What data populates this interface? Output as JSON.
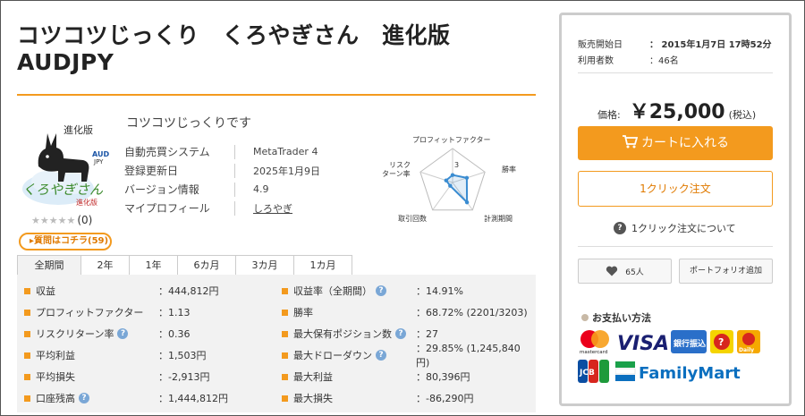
{
  "product": {
    "title": "コツコツじっくり　くろやぎさん　進化版 AUDJPY",
    "subtitle": "コツコツじっくりです",
    "review_count": "(0)",
    "qa_label": "▸質問はコチラ(59)",
    "logo": {
      "badge": "進化版",
      "pair_top": "AUD",
      "pair_bottom": "JPY",
      "script": "くろやぎさん",
      "script_sub": "進化版"
    },
    "info": [
      {
        "key": "自動売買システム",
        "value": "MetaTrader 4"
      },
      {
        "key": "登録更新日",
        "value": "2025年1月9日"
      },
      {
        "key": "バージョン情報",
        "value": "4.9"
      },
      {
        "key": "マイプロフィール",
        "value": "しろやぎ"
      }
    ]
  },
  "radar": {
    "labels": {
      "top": "プロフィットファクター",
      "right": "勝率",
      "bottom_right": "計測期間",
      "bottom_left": "取引回数",
      "left": "リスク\nターン率"
    },
    "center_value": "3",
    "values": [
      1.1,
      2.2,
      3.6,
      0.6,
      1.0
    ],
    "max": 5
  },
  "tabs": [
    "全期間",
    "2年",
    "1年",
    "6カ月",
    "3カ月",
    "1カ月"
  ],
  "stats_left": [
    {
      "label": "収益",
      "value": "：444,812円",
      "help": false
    },
    {
      "label": "プロフィットファクター",
      "value": "：1.13",
      "help": false
    },
    {
      "label": "リスクリターン率",
      "value": "：0.36",
      "help": true
    },
    {
      "label": "平均利益",
      "value": "：1,503円",
      "help": false
    },
    {
      "label": "平均損失",
      "value": "：-2,913円",
      "help": false
    },
    {
      "label": "口座残高",
      "value": "：1,444,812円",
      "help": true
    }
  ],
  "stats_right": [
    {
      "label": "収益率（全期間）",
      "value": "：14.91%",
      "help": true
    },
    {
      "label": "勝率",
      "value": "：68.72% (2201/3203)",
      "help": false
    },
    {
      "label": "最大保有ポジション数",
      "value": "：27",
      "help": true
    },
    {
      "label": "最大ドローダウン",
      "value": "：29.85% (1,245,840円)",
      "help": true
    },
    {
      "label": "最大利益",
      "value": "：80,396円",
      "help": false
    },
    {
      "label": "最大損失",
      "value": "：-86,290円",
      "help": false
    }
  ],
  "sidebar": {
    "sale_start_label": "販売開始日",
    "sale_start_value": "：  2015年1月7日 17時52分",
    "users_label": "利用者数",
    "users_value": "：46名",
    "price_label": "価格:",
    "price_value": "￥25,000",
    "price_tax": "(税込)",
    "cart_label": "カートに入れる",
    "oneclick_label": "1クリック注文",
    "about_oneclick": "1クリック注文について",
    "fav_count": "65人",
    "portfolio_label": "ポートフォリオ追加",
    "payment_title": "お支払い方法",
    "payment": {
      "mastercard": "mastercard",
      "visa": "VISA",
      "bank": "銀行振込",
      "jcb": "JCB",
      "family": "FamilyMart",
      "daily": "Daily"
    }
  },
  "colors": {
    "accent": "#f39a1e",
    "panel": "#f2f2f2",
    "help": "#7aa7d6",
    "radar_line": "#3a8cd1"
  }
}
